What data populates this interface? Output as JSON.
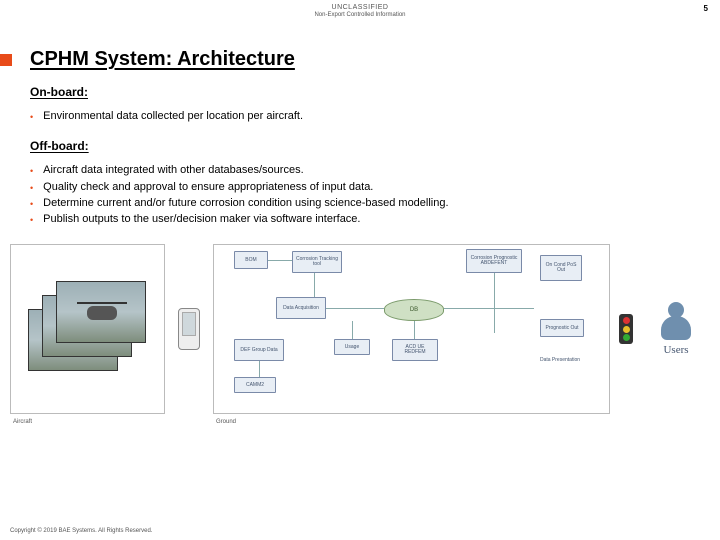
{
  "header": {
    "classification": "UNCLASSIFIED",
    "export": "Non-Export Controlled Information",
    "page_number": "5"
  },
  "title": "CPHM System: Architecture",
  "sections": {
    "onboard_label": "On-board:",
    "onboard_bullets": [
      "Environmental data collected per location per aircraft."
    ],
    "offboard_label": "Off-board:",
    "offboard_bullets": [
      "Aircraft data integrated with other databases/sources.",
      "Quality check and approval to ensure appropriateness of input data.",
      "Determine current and/or future corrosion condition using science-based modelling.",
      "Publish outputs to the user/decision maker via software interface."
    ]
  },
  "diagram": {
    "aircraft_panel_label": "Aircraft",
    "ground_panel_label": "Ground",
    "nodes": {
      "bom": "BOM",
      "corr_tracking": "Corrosion Tracking tool",
      "data_acq": "Data Acquisition",
      "def_group": "DEF Group Data",
      "camm2": "CAMM2",
      "db": "DB",
      "usage": "Usage",
      "acd": "ACD UE REDFEM",
      "corr_prog": "Corrosion Prognostic ABDEFENT",
      "on_cond": "On Cond PoS Out",
      "prog_out": "Prognostic Out",
      "data_pres": "Data Presentation"
    },
    "users_label": "Users"
  },
  "footer": {
    "copyright": "Copyright © 2019 BAE Systems. All Rights Reserved."
  }
}
